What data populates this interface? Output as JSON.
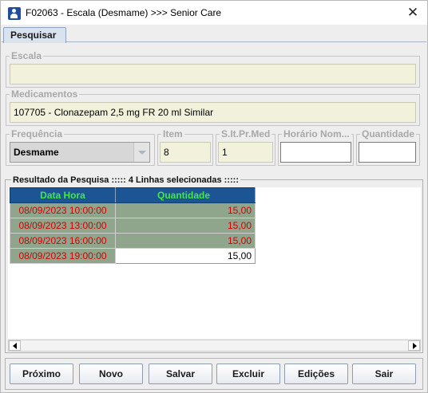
{
  "window": {
    "title": "F02063 - Escala (Desmame) >>> Senior Care",
    "close_glyph": "✕"
  },
  "tabs": [
    {
      "label": "Pesquisar",
      "active": true
    }
  ],
  "form": {
    "escala": {
      "label": "Escala",
      "value": ""
    },
    "medicamentos": {
      "label": "Medicamentos",
      "value": "107705 - Clonazepam   2,5 mg  FR  20 ml   Similar"
    },
    "frequencia": {
      "label": "Frequência",
      "value": "Desmame"
    },
    "item": {
      "label": "Item",
      "value": "8"
    },
    "sitprmed": {
      "label": "S.It.Pr.Med",
      "value": "1"
    },
    "horario": {
      "label": "Horário Nom...",
      "value": ""
    },
    "quantidade": {
      "label": "Quantidade",
      "value": ""
    }
  },
  "results": {
    "label": "Resultado da Pesquisa ::::: 4 Linhas selecionadas :::::",
    "columns": [
      "Data Hora",
      "Quantidade"
    ],
    "rows": [
      {
        "data_hora": "08/09/2023 10:00:00",
        "quantidade": "15,00"
      },
      {
        "data_hora": "08/09/2023 13:00:00",
        "quantidade": "15,00"
      },
      {
        "data_hora": "08/09/2023 16:00:00",
        "quantidade": "15,00"
      },
      {
        "data_hora": "08/09/2023 19:00:00",
        "quantidade": "15,00"
      }
    ]
  },
  "buttons": {
    "proximo": "Próximo",
    "novo": "Novo",
    "salvar": "Salvar",
    "excluir": "Excluir",
    "edicoes": "Edições",
    "sair": "Sair"
  },
  "colors": {
    "header_bg": "#1c5594",
    "header_text": "#43e843",
    "row_highlight": "#8fa58c",
    "row_text": "#d40000",
    "readonly_field": "#f2f2dc"
  },
  "icons": {
    "app": "person-card-icon",
    "close": "close-icon",
    "scroll_left": "arrow-left-icon",
    "scroll_right": "arrow-right-icon",
    "combo": "chevron-down-icon"
  }
}
